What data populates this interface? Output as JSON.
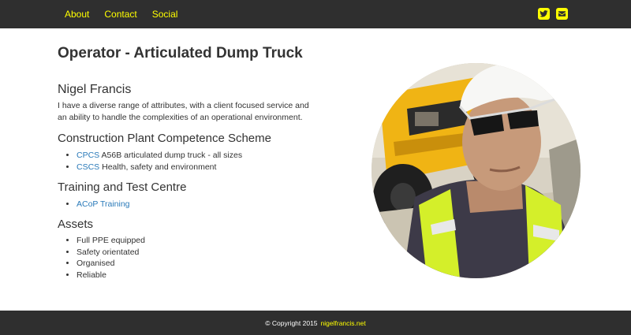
{
  "nav": {
    "links": [
      "About",
      "Contact",
      "Social"
    ],
    "icons": [
      "twitter-icon",
      "envelope-icon"
    ],
    "accent": "#ffff00",
    "background": "#2f2f2f"
  },
  "main": {
    "title": "Operator - Articulated Dump Truck",
    "name": "Nigel Francis",
    "bio": "I have a diverse range of attributes, with a client focused service and an ability to handle the complexities of an operational environment.",
    "cpcs": {
      "heading": "Construction Plant Competence Scheme",
      "items": [
        {
          "link": "CPCS",
          "text": " A56B articulated dump truck - all sizes"
        },
        {
          "link": "CSCS",
          "text": " Health, safety and environment"
        }
      ]
    },
    "training": {
      "heading": "Training and Test Centre",
      "items": [
        {
          "link": "ACoP Training"
        }
      ]
    },
    "assets": {
      "heading": "Assets",
      "items": [
        "Full PPE equipped",
        "Safety orientated",
        "Organised",
        "Reliable"
      ]
    },
    "link_color": "#2a7ab9"
  },
  "footer": {
    "copyright": "© Copyright 2015",
    "site_link": "nigelfrancis.net"
  }
}
